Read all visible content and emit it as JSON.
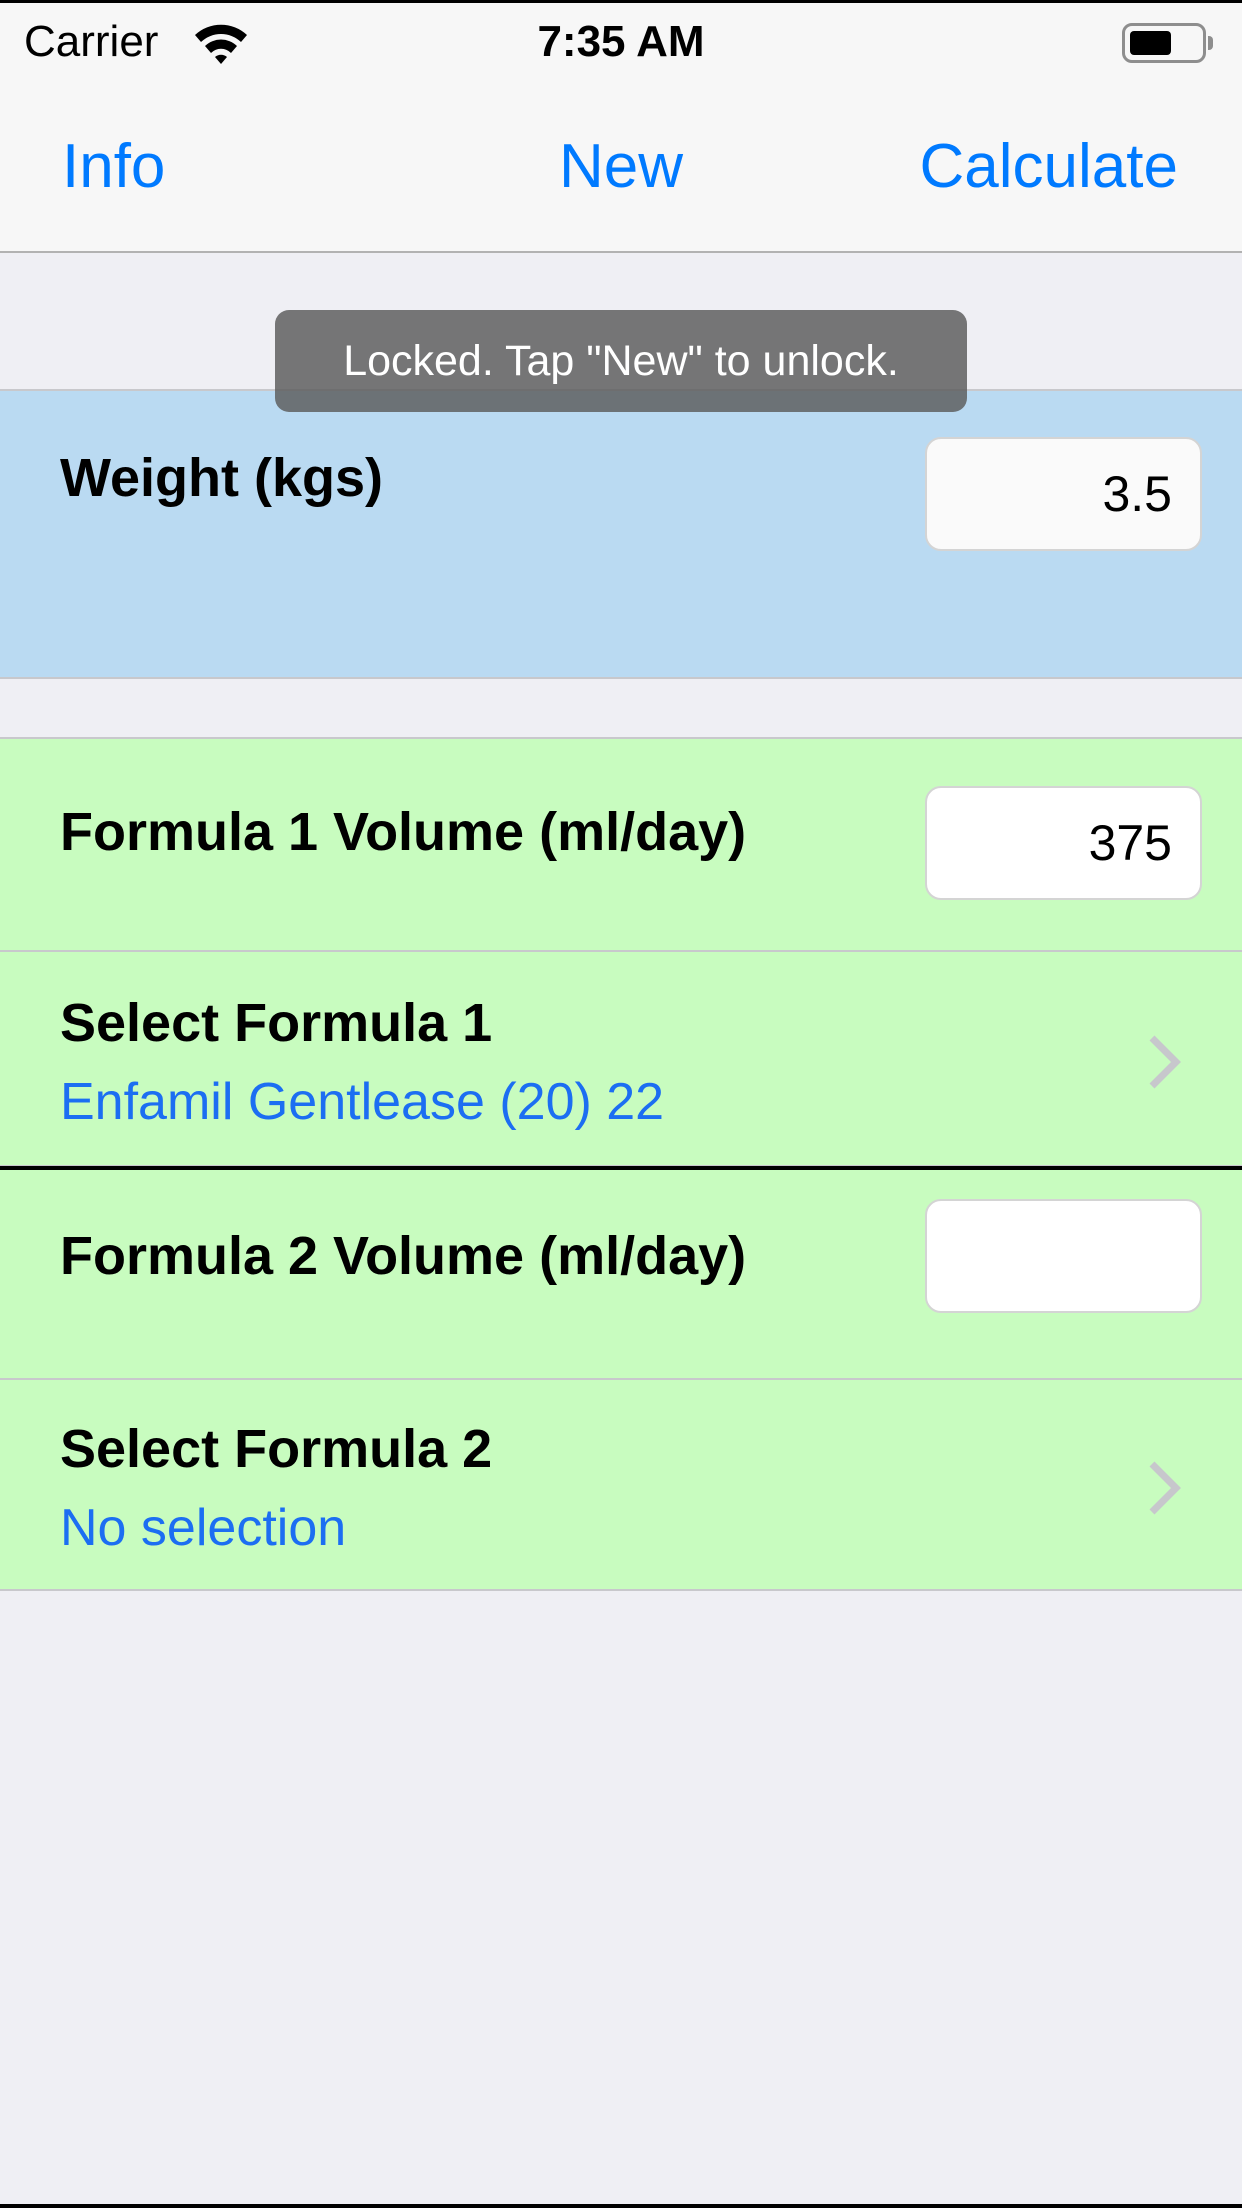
{
  "status_bar": {
    "carrier": "Carrier",
    "wifi_icon": "wifi-icon",
    "time": "7:35 AM",
    "battery_icon": "battery-icon",
    "battery_level": 0.6
  },
  "nav": {
    "info_label": "Info",
    "new_label": "New",
    "calculate_label": "Calculate"
  },
  "toast": {
    "message": "Locked. Tap \"New\" to unlock."
  },
  "weight": {
    "label": "Weight (kgs)",
    "value": "3.5"
  },
  "formula1": {
    "volume_label": "Formula 1 Volume (ml/day)",
    "volume_value": "375",
    "select_label": "Select Formula 1",
    "selection": "Enfamil Gentlease (20) 22"
  },
  "formula2": {
    "volume_label": "Formula 2 Volume (ml/day)",
    "volume_value": "",
    "select_label": "Select Formula 2",
    "selection": "No selection"
  },
  "colors": {
    "accent": "#007aff",
    "weight_section_bg": "#badaf2",
    "formula_section_bg": "#c8fcbf",
    "page_bg": "#efeff4",
    "chevron": "#c7c7cc"
  }
}
